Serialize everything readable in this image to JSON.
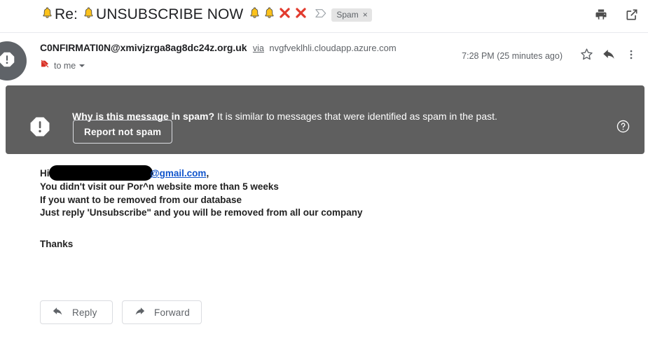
{
  "subject": {
    "prefix_bell": "bell-icon",
    "text_part_1": "Re:",
    "text_part_2": "UNSUBSCRIBE NOW",
    "full_text": "Re: UNSUBSCRIBE NOW",
    "label_chip": "Spam",
    "label_chip_remove": "×",
    "bell_count": 4,
    "x_mark_count": 2
  },
  "header_actions": {
    "print": "print-icon",
    "open_in_new": "open-in-new-window-icon"
  },
  "sender": {
    "email": "C0NFIRMATI0N@xmivjzrga8ag8dc24z.org.uk",
    "via_label": "via",
    "via_host": "nvgfveklhli.cloudapp.azure.com",
    "recipient": "to me",
    "timestamp": "7:28 PM (25 minutes ago)",
    "avatar_icon": "warning-octagon-icon"
  },
  "message_actions": {
    "star": "star-icon",
    "reply": "reply-arrow-icon",
    "more": "more-vert-icon"
  },
  "spam_banner": {
    "question": "Why is this message in spam?",
    "reason": " It is similar to messages that were identified as spam in the past.",
    "report_button": "Report not spam",
    "help": "help-circle-icon",
    "background_color": "#5f5f5f"
  },
  "body": {
    "greeting_prefix": "Hi",
    "greeting_domain": "@gmail.com",
    "greeting_suffix": ",",
    "line_2": "You didn't visit our Por^n website more than 5 weeks",
    "line_3": "If you want to be removed from our database",
    "line_4": "Just reply 'Unsubscribe\" and you will be removed from all our company",
    "closing": "Thanks"
  },
  "footer": {
    "reply_label": "Reply",
    "forward_label": "Forward"
  },
  "colors": {
    "link": "#1155cc",
    "banner": "#5f5f5f",
    "text": "#202124",
    "muted": "#5f6368",
    "chip_bg": "#e4e4e4"
  }
}
